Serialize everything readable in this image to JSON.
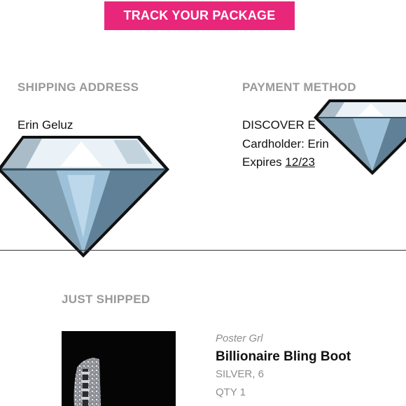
{
  "header": {
    "track_button_label": "TRACK YOUR PACKAGE"
  },
  "shipping": {
    "heading": "SHIPPING ADDRESS",
    "name": "Erin Geluz"
  },
  "payment": {
    "heading": "PAYMENT METHOD",
    "card_line": "DISCOVER E",
    "cardholder_line": "Cardholder: Erin",
    "expires_label": "Expires",
    "expires_value": "12/23"
  },
  "just_shipped": {
    "heading": "JUST SHIPPED",
    "item": {
      "brand": "Poster Grl",
      "name": "Billionaire Bling Boot",
      "variant": "SILVER, 6",
      "qty": "QTY 1"
    }
  },
  "colors": {
    "accent": "#e8277a",
    "muted": "#999999"
  },
  "stickers": [
    "diamond-sticker",
    "diamond-sticker"
  ]
}
